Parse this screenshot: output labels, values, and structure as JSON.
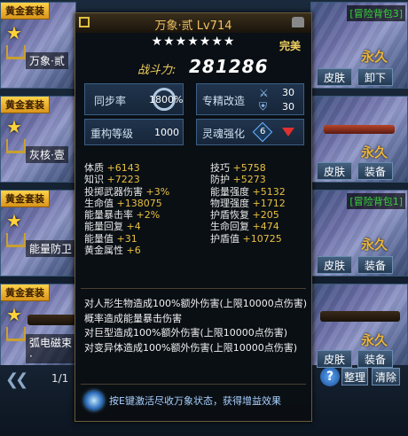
{
  "cards": [
    {
      "tag": "黄金套装",
      "name": "万象·贰",
      "skin": "皮肤",
      "action": "卸下",
      "perm": "永久",
      "backpack": "[冒险背包3]"
    },
    {
      "tag": "黄金套装",
      "name": "灰核·壹",
      "skin": "皮肤",
      "action": "装备",
      "perm": "永久",
      "backpack": "[背包3]"
    },
    {
      "tag": "黄金套装",
      "name": "能量防卫",
      "skin": "皮肤",
      "action": "装备",
      "perm": "永久",
      "backpack": "[冒险背包1]"
    },
    {
      "tag": "黄金套装",
      "name": "弧电磁束·",
      "skin": "皮肤",
      "action": "装备",
      "perm": "永久",
      "backpack": ""
    }
  ],
  "tooltip": {
    "title": "万象·贰 Lv714",
    "stars": "★★★★★★★",
    "perfect": "完美",
    "power_label": "战斗力:",
    "power_value": "281286",
    "sync_label": "同步率",
    "sync_value": "1800%",
    "sync_fraction": 1.0,
    "mod_label": "专精改造",
    "mod_value_1": "30",
    "mod_value_2": "30",
    "refit_label": "重构等级",
    "refit_value": "1000",
    "soul_label": "灵魂强化",
    "soul_value": "6",
    "stats": [
      {
        "k1": "体质",
        "v1": "+6143",
        "k2": "技巧",
        "v2": "+5758"
      },
      {
        "k1": "知识",
        "v1": "+7223",
        "k2": "防护",
        "v2": "+5273"
      },
      {
        "k1": "投掷武器伤害",
        "v1": "+3%",
        "k2": "能量强度",
        "v2": "+5132"
      },
      {
        "k1": "生命值",
        "v1": "+138075",
        "k2": "物理强度",
        "v2": "+1712"
      },
      {
        "k1": "能量暴击率",
        "v1": "+2%",
        "k2": "护盾恢复",
        "v2": "+205"
      },
      {
        "k1": "能量回复",
        "v1": "+4",
        "k2": "生命回复",
        "v2": "+474"
      },
      {
        "k1": "能量值",
        "v1": "+31",
        "k2": "护盾值",
        "v2": "+10725"
      },
      {
        "k1": "黄金属性",
        "v1": "+6",
        "k2": "",
        "v2": ""
      }
    ],
    "desc": [
      "对人形生物造成100%额外伤害(上限10000点伤害)",
      "概率造成能量暴击伤害",
      "对巨型造成100%额外伤害(上限10000点伤害)",
      "对变异体造成100%额外伤害(上限10000点伤害)"
    ],
    "hint": "按E键激活尽收万象状态，获得增益效果"
  },
  "footer": {
    "page": "1/1",
    "sort_label": "整理",
    "clear_label": "清除",
    "help_label": "?"
  }
}
